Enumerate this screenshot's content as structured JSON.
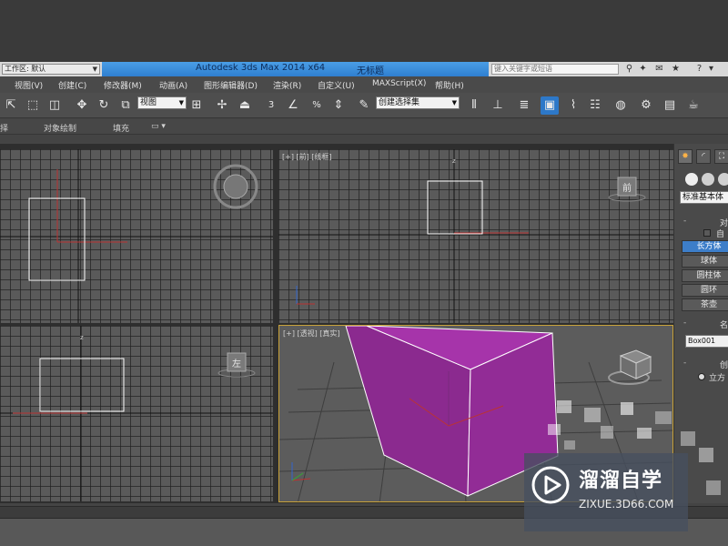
{
  "titlebar": {
    "workspace": "工作区: 默认",
    "app_title": "Autodesk 3ds Max  2014 x64",
    "document": "无标题",
    "search_placeholder": "键入关键字或短语"
  },
  "menu": {
    "items": [
      "视图(V)",
      "创建(C)",
      "修改器(M)",
      "动画(A)",
      "图形编辑器(D)",
      "渲染(R)",
      "自定义(U)",
      "MAXScript(X)",
      "帮助(H)"
    ]
  },
  "toolbar": {
    "view_select": "视图",
    "selection_set": "创建选择集",
    "snap_3": "3",
    "snap_percent": "%",
    "icons": [
      "select-region-icon",
      "window-cross-icon",
      "move-icon",
      "rotate-icon",
      "scale-icon",
      "pick-pivot-icon",
      "snap-toggle-icon",
      "angle-snap-icon",
      "percent-snap-icon",
      "spinner-snap-icon",
      "edit-named-selection-icon",
      "mirror-icon",
      "align-icon",
      "layer-manager-icon",
      "scene-explorer-icon",
      "curve-editor-icon",
      "schematic-view-icon",
      "material-editor-icon",
      "render-setup-icon",
      "rendered-frame-icon",
      "render-icon"
    ]
  },
  "ribbon": {
    "items": [
      "择",
      "对象绘制",
      "填充"
    ]
  },
  "viewports": {
    "front_label": "[+] [前] [线框]",
    "perspective_label": "[+] [透视] [真实]",
    "axis_z": "z",
    "left_axis_label": "F",
    "front_label_nav": "前",
    "left_nav": "左"
  },
  "command_panel": {
    "primitive_type": "标准基本体",
    "object_type_header": "对",
    "autogrid": "自",
    "buttons": [
      "长方体",
      "球体",
      "圆柱体",
      "圆环",
      "茶壶"
    ],
    "active_button": "长方体",
    "name_header": "名",
    "object_name": "Box001",
    "creation_header": "创",
    "radio_label": "立方"
  },
  "colors": {
    "accent": "#2d78c8",
    "box_fill": "#8b2a8f",
    "box_edge": "#ffffff",
    "viewport_bg": "#5a5a5a"
  },
  "watermark": {
    "brand": "溜溜自学",
    "url": "ZIXUE.3D66.COM"
  }
}
